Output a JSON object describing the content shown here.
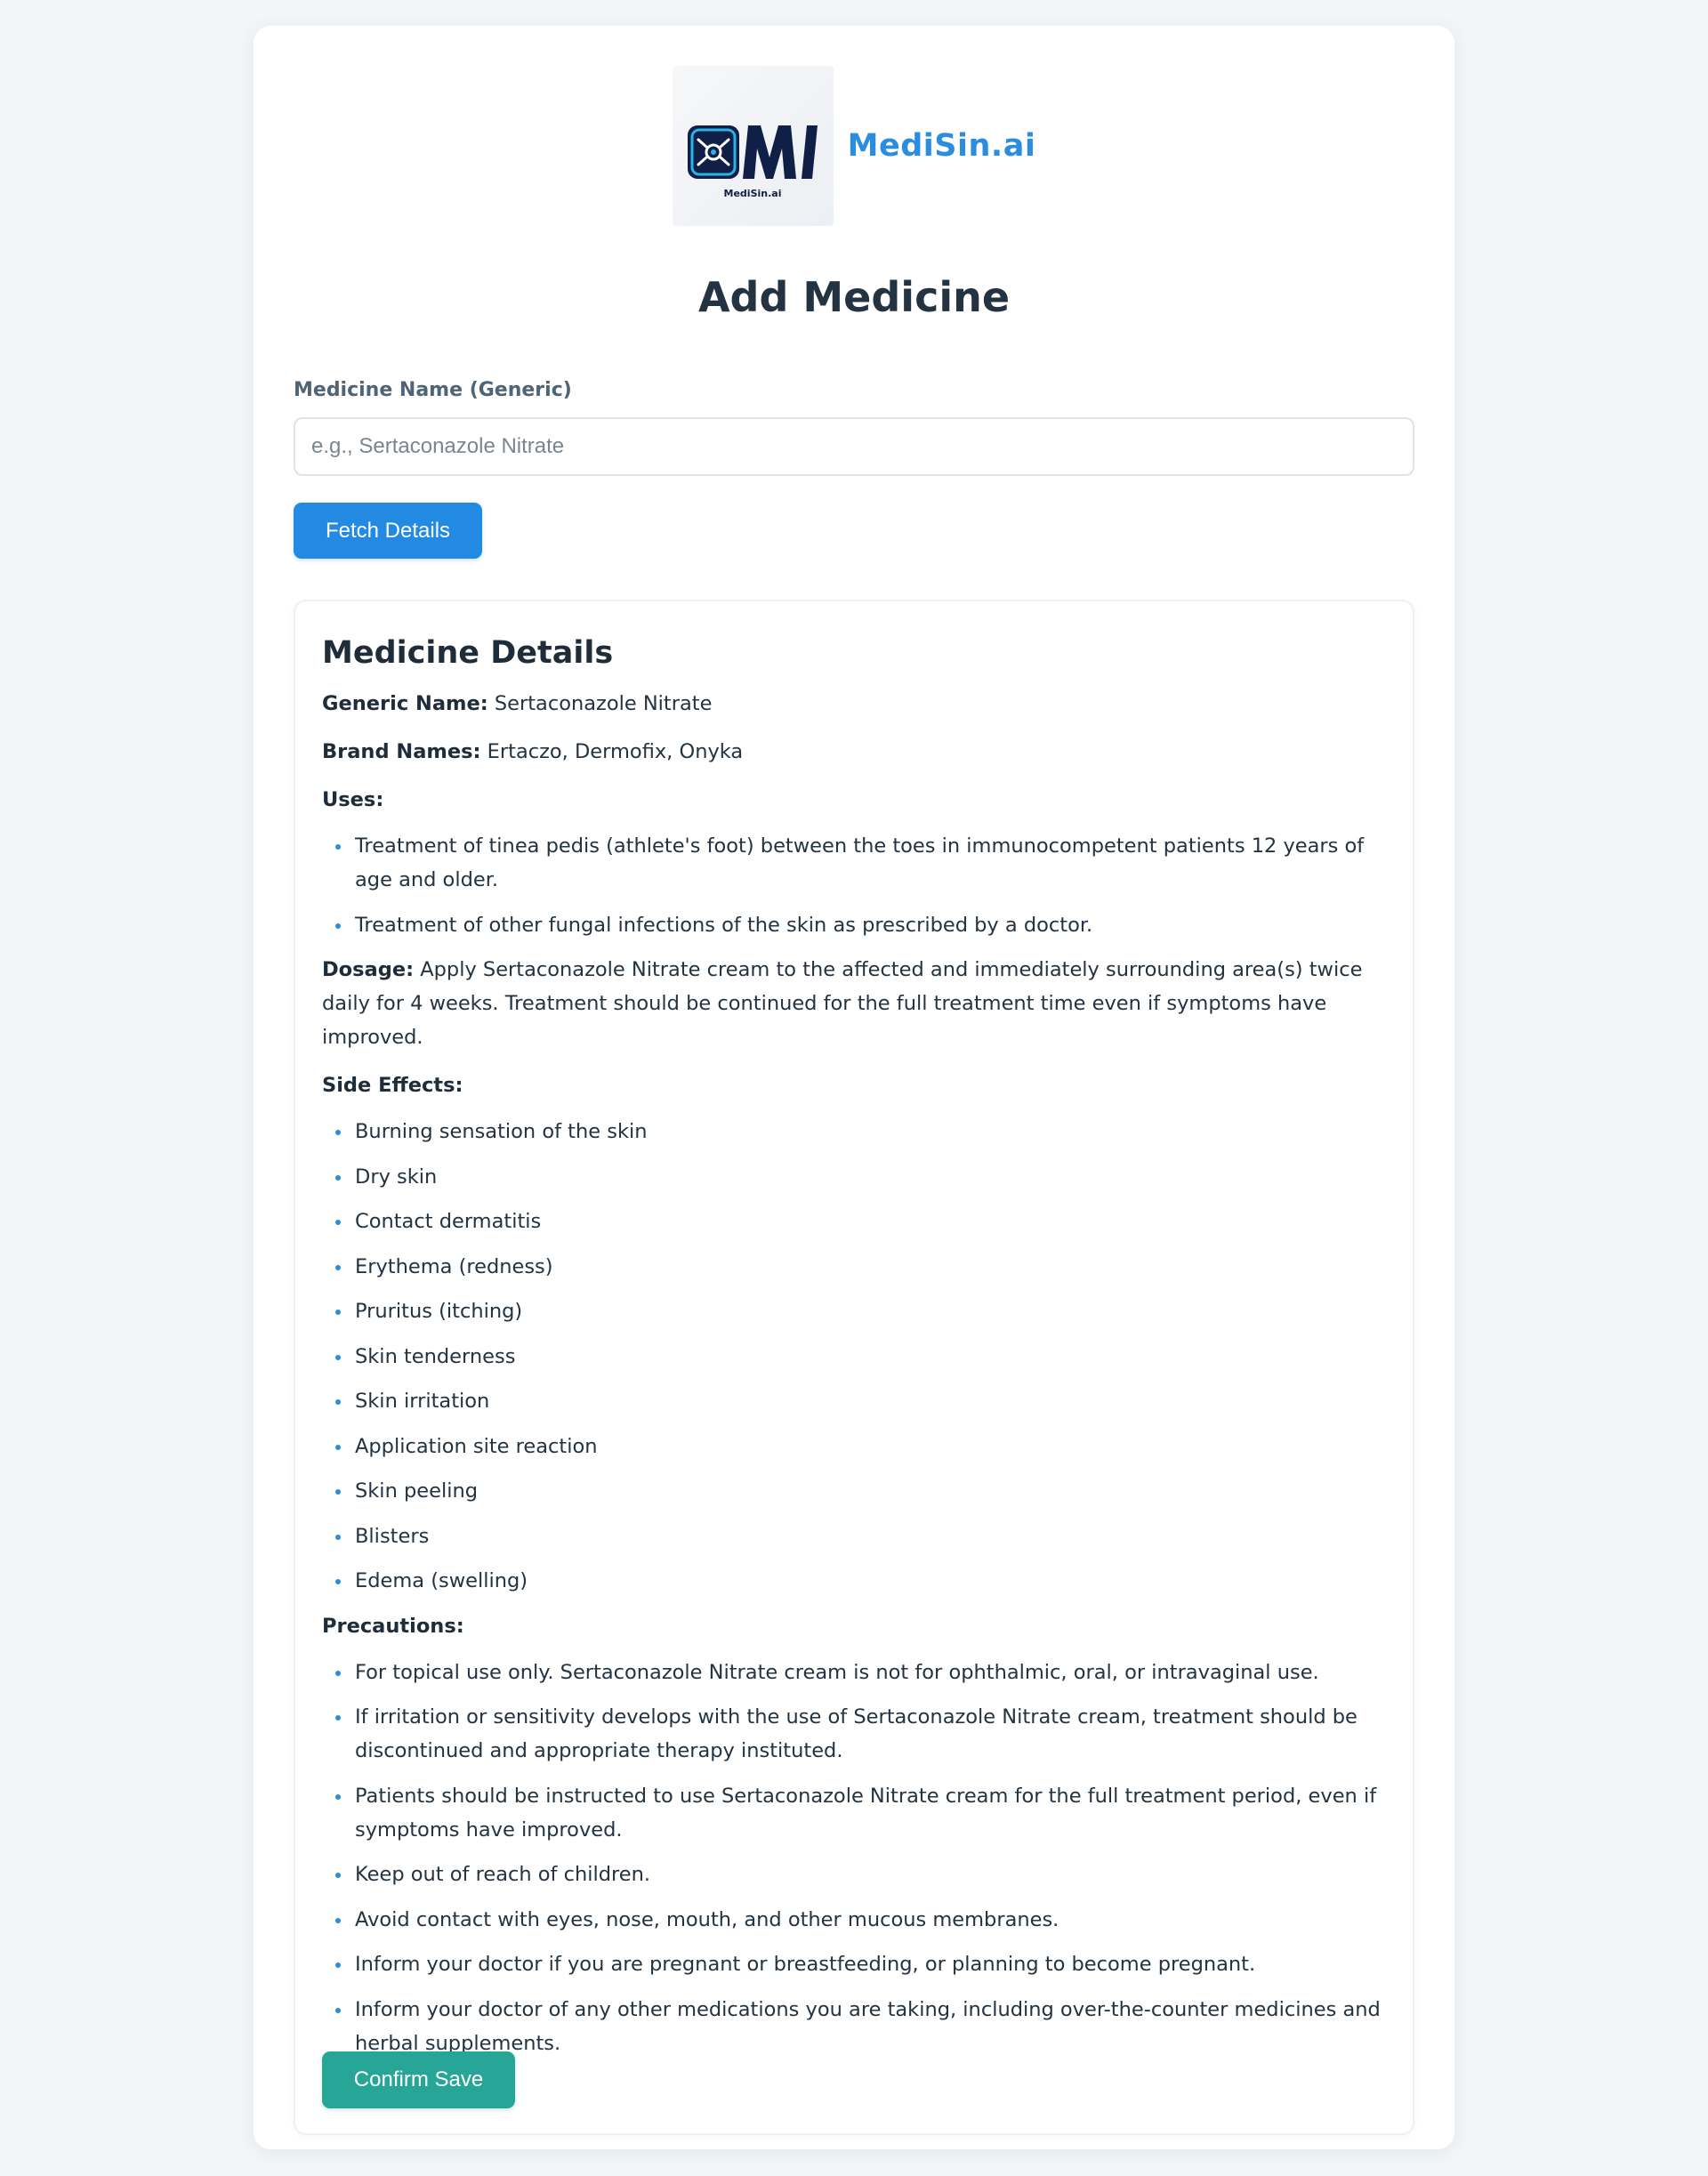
{
  "brand": {
    "name": "MediSin.ai",
    "logo_caption": "MediSin.ai",
    "logo_icon": "medisin-logo-icon",
    "color": "#2b8de0"
  },
  "page": {
    "title": "Add Medicine"
  },
  "form": {
    "name_label": "Medicine Name (Generic)",
    "name_placeholder": "e.g., Sertaconazole Nitrate",
    "name_value": "",
    "fetch_label": "Fetch Details"
  },
  "details": {
    "title": "Medicine Details",
    "generic_label": "Generic Name:",
    "generic_value": "Sertaconazole Nitrate",
    "brands_label": "Brand Names:",
    "brands_value": "Ertaczo, Dermofix, Onyka",
    "uses_label": "Uses:",
    "uses": [
      "Treatment of tinea pedis (athlete's foot) between the toes in immunocompetent patients 12 years of age and older.",
      "Treatment of other fungal infections of the skin as prescribed by a doctor."
    ],
    "dosage_label": "Dosage:",
    "dosage_value": "Apply Sertaconazole Nitrate cream to the affected and immediately surrounding area(s) twice daily for 4 weeks. Treatment should be continued for the full treatment time even if symptoms have improved.",
    "side_effects_label": "Side Effects:",
    "side_effects": [
      "Burning sensation of the skin",
      "Dry skin",
      "Contact dermatitis",
      "Erythema (redness)",
      "Pruritus (itching)",
      "Skin tenderness",
      "Skin irritation",
      "Application site reaction",
      "Skin peeling",
      "Blisters",
      "Edema (swelling)"
    ],
    "precautions_label": "Precautions:",
    "precautions": [
      "For topical use only. Sertaconazole Nitrate cream is not for ophthalmic, oral, or intravaginal use.",
      "If irritation or sensitivity develops with the use of Sertaconazole Nitrate cream, treatment should be discontinued and appropriate therapy instituted.",
      "Patients should be instructed to use Sertaconazole Nitrate cream for the full treatment period, even if symptoms have improved.",
      "Keep out of reach of children.",
      "Avoid contact with eyes, nose, mouth, and other mucous membranes.",
      "Inform your doctor if you are pregnant or breastfeeding, or planning to become pregnant.",
      "Inform your doctor of any other medications you are taking, including over-the-counter medicines and herbal supplements."
    ],
    "confirm_label": "Confirm Save"
  },
  "colors": {
    "primary_button": "#238ae4",
    "confirm_button": "#27a697",
    "bullet": "#2b8de0",
    "page_background": "#f2f6f9"
  }
}
